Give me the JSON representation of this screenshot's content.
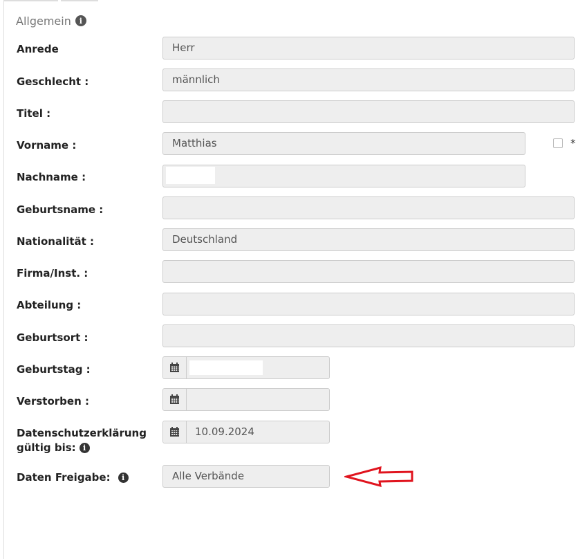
{
  "section": {
    "title": "Allgemein",
    "info_icon": "info-icon"
  },
  "fields": {
    "anrede": {
      "label": "Anrede",
      "value": "Herr"
    },
    "geschlecht": {
      "label": "Geschlecht :",
      "value": "männlich"
    },
    "titel": {
      "label": "Titel :",
      "value": ""
    },
    "vorname": {
      "label": "Vorname :",
      "value": "Matthias",
      "marker": "*"
    },
    "nachname": {
      "label": "Nachname :",
      "value": ""
    },
    "geburtsname": {
      "label": "Geburtsname :",
      "value": ""
    },
    "nationalitaet": {
      "label": "Nationalität :",
      "value": "Deutschland"
    },
    "firma": {
      "label": "Firma/Inst. :",
      "value": ""
    },
    "abteilung": {
      "label": "Abteilung :",
      "value": ""
    },
    "geburtsort": {
      "label": "Geburtsort :",
      "value": ""
    },
    "geburtstag": {
      "label": "Geburtstag :",
      "value": "",
      "icon": "calendar-icon"
    },
    "verstorben": {
      "label": "Verstorben :",
      "value": "",
      "icon": "calendar-icon"
    },
    "datenschutz": {
      "label_line1": "Datenschutzerklärung",
      "label_line2": "gültig bis:",
      "value": "10.09.2024",
      "icon": "calendar-icon"
    },
    "freigabe": {
      "label": "Daten Freigabe:",
      "value": "Alle Verbände"
    }
  },
  "colors": {
    "field_bg": "#eeeeee",
    "field_border": "#cccccc",
    "arrow": "#e0141e"
  }
}
